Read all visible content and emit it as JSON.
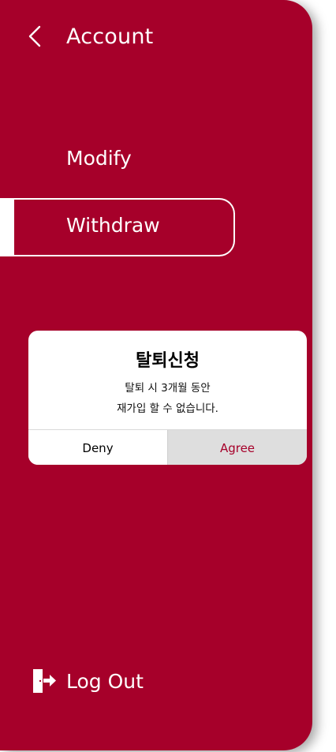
{
  "header": {
    "title": "Account",
    "back_icon": "chevron-left-icon"
  },
  "menu": {
    "items": [
      {
        "label": "Modify",
        "selected": false
      },
      {
        "label": "Withdraw",
        "selected": true
      }
    ]
  },
  "dialog": {
    "title": "탈퇴신청",
    "message_line1": "탈퇴 시 3개월 동안",
    "message_line2": "재가입 할 수 없습니다.",
    "deny_label": "Deny",
    "agree_label": "Agree"
  },
  "footer": {
    "logout_label": "Log Out",
    "logout_icon": "logout-door-icon"
  },
  "colors": {
    "brand": "#a6002a",
    "white": "#ffffff",
    "agree_bg": "#dedede"
  }
}
